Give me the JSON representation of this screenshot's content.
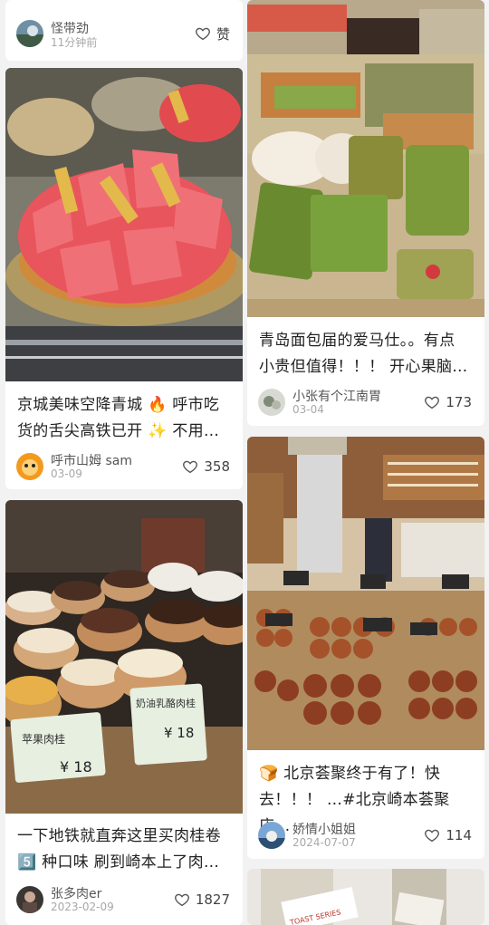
{
  "cards": [
    {
      "author": "怪带劲",
      "time": "11分钟前",
      "like_label": "赞"
    },
    {
      "title_line1": "京城美味空降青城 🔥 呼市吃",
      "title_line2": "货的舌尖高铁已开 ✨ 不用…",
      "author": "呼市山姆 sam",
      "time": "03-09",
      "likes": "358"
    },
    {
      "title_line1": "一下地铁就直奔这里买肉桂卷",
      "title_line2": "5️⃣ 种口味 刷到崎本上了肉…",
      "author": "张多肉er",
      "time": "2023-02-09",
      "likes": "1827",
      "tags": [
        "苹果肉桂",
        "奶油乳酪肉桂"
      ],
      "prices": [
        "¥ 18",
        "¥ 18"
      ]
    },
    {
      "title_line1": "青岛面包届的爱马仕。。有点",
      "title_line2": "小贵但值得！！！ 开心果脑…",
      "author": "小张有个江南胃",
      "time": "03-04",
      "likes": "173"
    },
    {
      "title_line1": "🍞 北京荟聚终于有了！快",
      "title_line2": "去！！！ …#北京崎本荟聚店…",
      "author": "娇情小姐姐",
      "time": "2024-07-07",
      "likes": "114"
    },
    {
      "tag": "TOAST SERIES"
    }
  ]
}
